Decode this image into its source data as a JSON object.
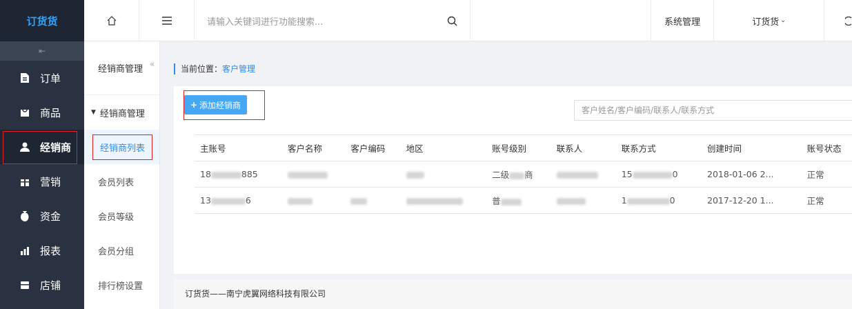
{
  "app": {
    "logo": "订货货"
  },
  "sidebar": {
    "collapse_icon": "≡",
    "items": [
      {
        "label": "订单",
        "icon": "document-icon"
      },
      {
        "label": "商品",
        "icon": "bag-icon"
      },
      {
        "label": "经销商",
        "icon": "user-icon",
        "active": true
      },
      {
        "label": "营销",
        "icon": "gift-icon"
      },
      {
        "label": "资金",
        "icon": "money-bag-icon"
      },
      {
        "label": "报表",
        "icon": "chart-icon"
      },
      {
        "label": "店铺",
        "icon": "store-icon"
      }
    ]
  },
  "topbar": {
    "search_placeholder": "请输入关键词进行功能搜索...",
    "system_label": "系统管理",
    "user_label": "订货货"
  },
  "subnav": {
    "title": "经销商管理",
    "collapse": "«",
    "group": "经销商管理",
    "items": [
      "经销商列表",
      "会员列表",
      "会员等级",
      "会员分组",
      "排行榜设置"
    ]
  },
  "breadcrumb": {
    "prefix": "当前位置：",
    "current": "客户管理"
  },
  "toolbar": {
    "add_label": "添加经销商",
    "filter_placeholder": "客户姓名/客户编码/联系人/联系方式"
  },
  "table": {
    "headers": [
      "主账号",
      "客户名称",
      "客户编码",
      "地区",
      "账号级别",
      "联系人",
      "联系方式",
      "创建时间",
      "账号状态"
    ],
    "rows": [
      {
        "account_start": "18",
        "account_end": "885",
        "level_start": "二级",
        "level_end": "商",
        "phone_start": "15",
        "phone_end": "0",
        "created": "2018-01-06 2...",
        "status": "正常"
      },
      {
        "account_start": "13",
        "account_end": "6",
        "level_start": "普",
        "level_end": "",
        "phone_start": "1",
        "phone_end": "0",
        "created": "2017-12-20 1...",
        "status": "正常"
      }
    ]
  },
  "footer": {
    "text": "订货货——南宁虎翼网络科技有限公司"
  },
  "colors": {
    "accent": "#2d8cf0",
    "sidebar": "#2a3241",
    "highlight": "#e02020"
  }
}
